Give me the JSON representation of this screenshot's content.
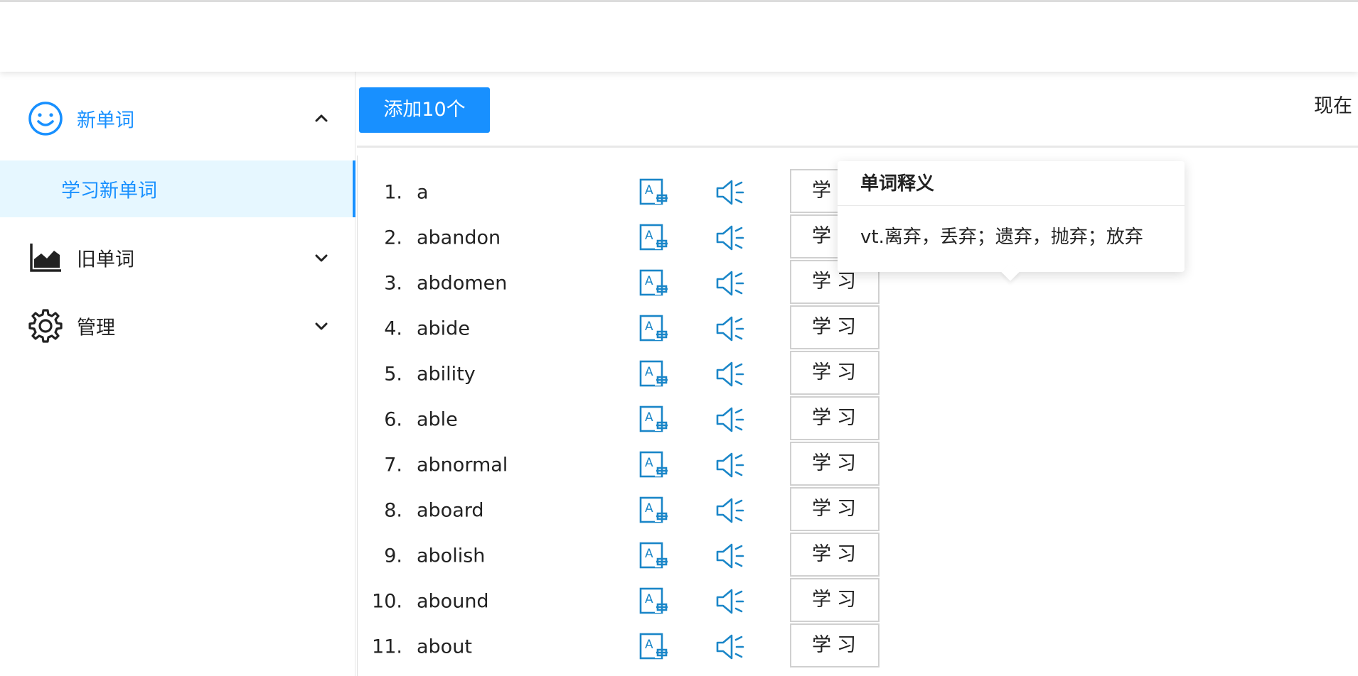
{
  "sidebar": {
    "menus": [
      {
        "label": "新单词",
        "icon": "smile-icon",
        "expanded": true,
        "active_color": "#1890ff"
      },
      {
        "label": "旧单词",
        "icon": "area-chart-icon",
        "expanded": false
      },
      {
        "label": "管理",
        "icon": "gear-icon",
        "expanded": false
      }
    ],
    "active_submenu": "学习新单词"
  },
  "toolbar": {
    "add_label": "添加10个",
    "status_text": "现在",
    "accent": "#1890ff"
  },
  "popover": {
    "title": "单词释义",
    "definition": "vt.离弃，丢弃；遗弃，抛弃；放弃"
  },
  "words": [
    {
      "num": "1.",
      "word": "a"
    },
    {
      "num": "2.",
      "word": "abandon"
    },
    {
      "num": "3.",
      "word": "abdomen"
    },
    {
      "num": "4.",
      "word": "abide"
    },
    {
      "num": "5.",
      "word": "ability"
    },
    {
      "num": "6.",
      "word": "able"
    },
    {
      "num": "7.",
      "word": "abnormal"
    },
    {
      "num": "8.",
      "word": "aboard"
    },
    {
      "num": "9.",
      "word": "abolish"
    },
    {
      "num": "10.",
      "word": "abound"
    },
    {
      "num": "11.",
      "word": "about"
    }
  ],
  "row_actions": {
    "learn_label": "学习",
    "definition_icon": "translate-icon",
    "pronounce_icon": "speaker-icon"
  }
}
